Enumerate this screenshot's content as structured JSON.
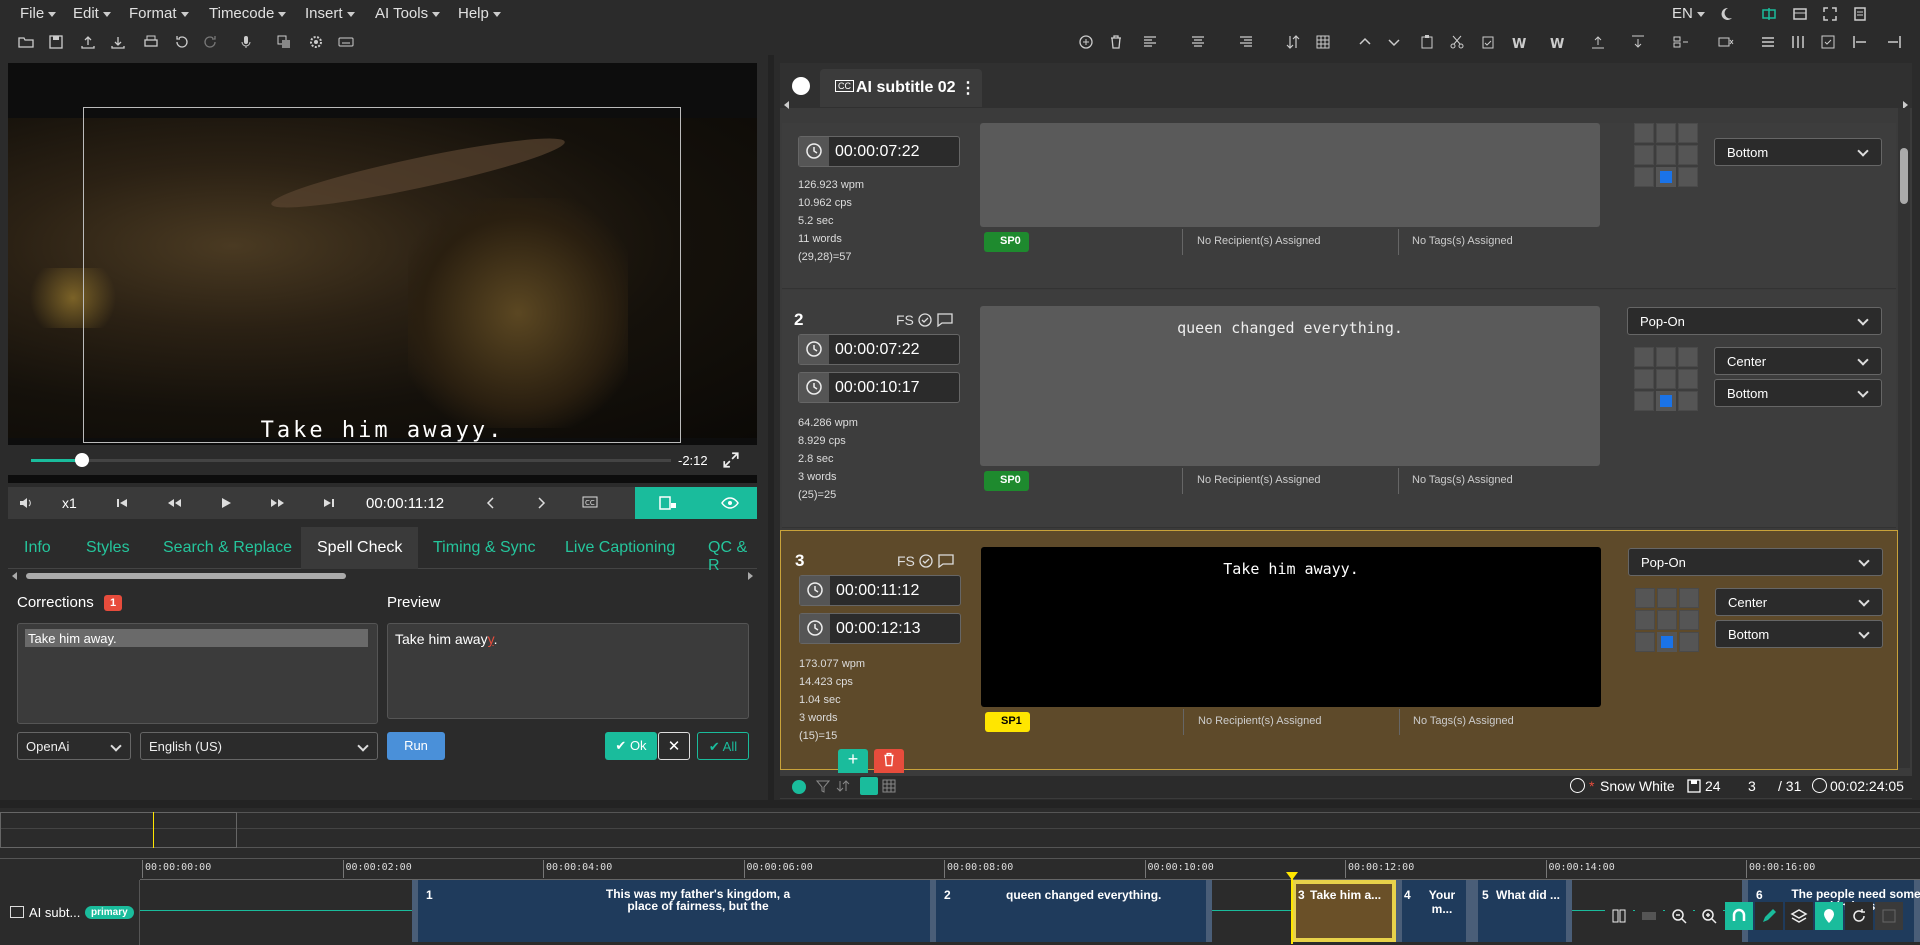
{
  "menu": {
    "file": "File",
    "edit": "Edit",
    "format": "Format",
    "timecode": "Timecode",
    "insert": "Insert",
    "ai_tools": "AI Tools",
    "help": "Help",
    "lang": "EN"
  },
  "player": {
    "subtitle": "Take him awayy.",
    "remaining": "-2:12",
    "speed": "x1",
    "timecode": "00:00:11:12",
    "progress": 0.08
  },
  "tabs": [
    "Info",
    "Styles",
    "Search & Replace",
    "Spell Check",
    "Timing & Sync",
    "Live Captioning",
    "QC & R"
  ],
  "spell": {
    "corrections_label": "Corrections",
    "corrections_count": "1",
    "preview_label": "Preview",
    "correction_text": "Take him away.",
    "preview_prefix": "Take him away",
    "preview_err": "y",
    "preview_suffix": ".",
    "engine": "OpenAi",
    "language": "English (US)",
    "run": "Run",
    "ok": "Ok",
    "all": "All"
  },
  "doc_tab": {
    "cc": "CC",
    "title": "AI subtitle 02"
  },
  "cards": [
    {
      "num": "",
      "out": "00:00:07:22",
      "stats": [
        "126.923 wpm",
        "10.962 cps",
        "5.2 sec",
        "11 words",
        "(29,28)=57"
      ],
      "speaker": "SP0",
      "rec": "No Recipient(s) Assigned",
      "tags": "No Tags(s) Assigned",
      "v": "Bottom"
    },
    {
      "num": "2",
      "fs": "FS",
      "in": "00:00:07:22",
      "out": "00:00:10:17",
      "text": "queen changed everything.",
      "stats": [
        "64.286 wpm",
        "8.929 cps",
        "2.8 sec",
        "3 words",
        "(25)=25"
      ],
      "speaker": "SP0",
      "rec": "No Recipient(s) Assigned",
      "tags": "No Tags(s) Assigned",
      "mode": "Pop-On",
      "h": "Center",
      "v": "Bottom"
    },
    {
      "num": "3",
      "fs": "FS",
      "in": "00:00:11:12",
      "out": "00:00:12:13",
      "text": "Take him awayy.",
      "stats": [
        "173.077 wpm",
        "14.423 cps",
        "1.04 sec",
        "3 words",
        "(15)=15"
      ],
      "speaker": "SP1",
      "rec": "No Recipient(s) Assigned",
      "tags": "No Tags(s) Assigned",
      "mode": "Pop-On",
      "h": "Center",
      "v": "Bottom"
    }
  ],
  "status": {
    "style": "Snow White",
    "count": "24",
    "current": "3",
    "total": "/ 31",
    "duration": "00:02:24:05"
  },
  "timeline": {
    "track": "AI subt...",
    "badge": "primary",
    "ticks": [
      "00:00:00:00",
      "00:00:02:00",
      "00:00:04:00",
      "00:00:06:00",
      "00:00:08:00",
      "00:00:10:00",
      "00:00:12:00",
      "00:00:14:00",
      "00:00:16:00"
    ],
    "clips": [
      {
        "n": "1",
        "t": "This was my father's kingdom, a place of fairness, but the"
      },
      {
        "n": "2",
        "t": "queen changed everything."
      },
      {
        "n": "3",
        "t": "Take him a..."
      },
      {
        "n": "4",
        "t": "Your m..."
      },
      {
        "n": "5",
        "t": "What did ..."
      },
      {
        "n": "6",
        "t": "The people need some kindness"
      }
    ]
  },
  "colors": {
    "accent": "#1abc9c",
    "selected_card": "#5e4a2a",
    "speaker0": "#1e8a2e",
    "speaker1": "#ffe600",
    "error": "#e74c3c"
  }
}
